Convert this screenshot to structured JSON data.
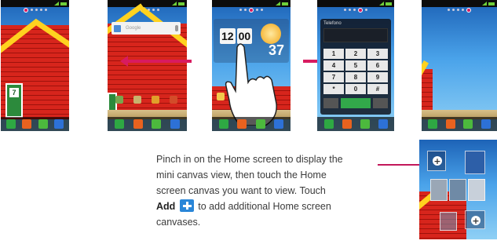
{
  "instructions": {
    "line1": "Pinch in on the Home screen to display the",
    "line2": "mini canvas view, then touch the Home",
    "line3": "screen canvas you want to view. Touch",
    "add_word": "Add",
    "line4_rest": " to add additional Home screen",
    "line5": "canvases."
  },
  "screen1": {
    "door_number": "7"
  },
  "screen2": {
    "search_placeholder": "Google"
  },
  "screen3": {
    "clock_hour": "12",
    "clock_minute": "00",
    "temperature": "37"
  },
  "screen4": {
    "title": "Telefono",
    "keys": [
      "1",
      "2",
      "3",
      "4",
      "5",
      "6",
      "7",
      "8",
      "9",
      "*",
      "0",
      "#"
    ]
  },
  "colors": {
    "accent": "#d81b60",
    "add_button": "#2a86d8"
  }
}
